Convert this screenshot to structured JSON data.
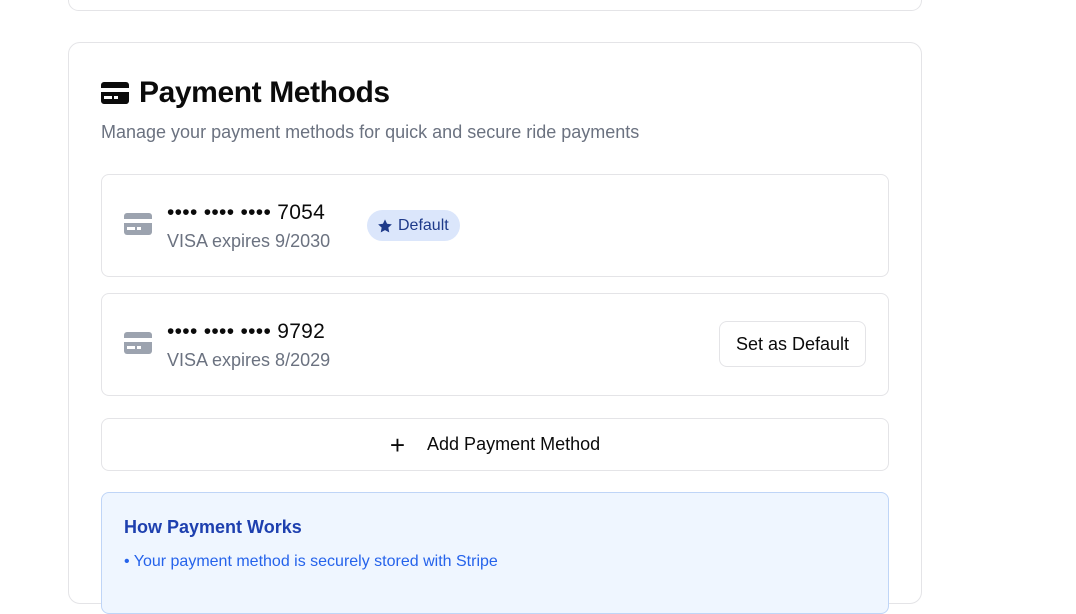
{
  "payment_methods": {
    "title": "Payment Methods",
    "subtitle": "Manage your payment methods for quick and secure ride payments",
    "title_icon": "credit-card-icon",
    "cards": [
      {
        "masked_number": "•••• •••• •••• 7054",
        "details": "VISA expires 9/2030",
        "is_default": true,
        "badge_label": "Default"
      },
      {
        "masked_number": "•••• •••• •••• 9792",
        "details": "VISA expires 8/2029",
        "is_default": false,
        "action_label": "Set as Default"
      }
    ],
    "add_button_icon": "+",
    "add_button_label": "Add Payment Method",
    "info": {
      "title": "How Payment Works",
      "lines": [
        "• Your payment method is securely stored with Stripe"
      ]
    }
  },
  "colors": {
    "badge_bg": "#dbe6fb",
    "badge_text": "#1e3a8a",
    "info_bg": "#eff6ff",
    "info_title": "#1e40af",
    "info_text": "#2563eb"
  }
}
